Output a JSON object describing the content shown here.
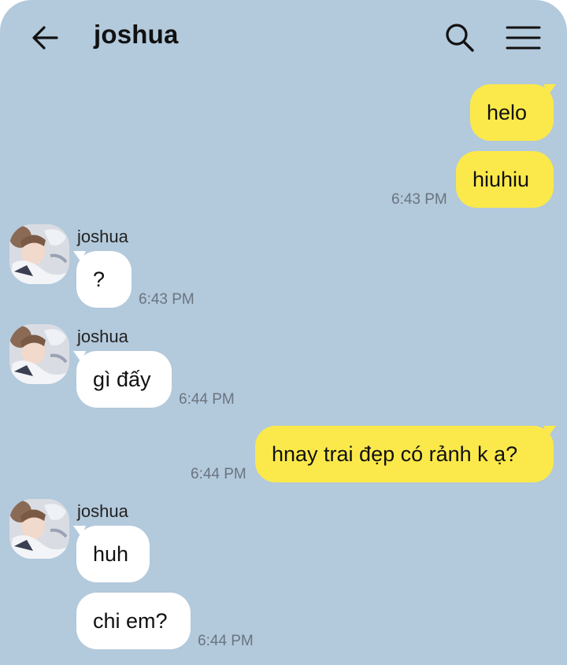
{
  "header": {
    "title": "joshua",
    "back_icon": "arrow-left-icon",
    "search_icon": "search-icon",
    "menu_icon": "hamburger-menu-icon"
  },
  "colors": {
    "background": "#b3c9dc",
    "outgoing_bubble": "#fbe94b",
    "incoming_bubble": "#ffffff"
  },
  "messages": [
    {
      "sender": "me",
      "text": "helo"
    },
    {
      "sender": "me",
      "text": "hiuhiu",
      "time": "6:43 PM"
    },
    {
      "sender": "joshua",
      "name": "joshua",
      "text": "?",
      "time": "6:43 PM"
    },
    {
      "sender": "joshua",
      "name": "joshua",
      "text": "gì đấy",
      "time": "6:44 PM"
    },
    {
      "sender": "me",
      "text": "hnay trai đẹp có rảnh k ạ?",
      "time": "6:44 PM"
    },
    {
      "sender": "joshua",
      "name": "joshua",
      "text": "huh"
    },
    {
      "sender": "joshua",
      "text": "chi em?",
      "time": "6:44 PM"
    }
  ]
}
